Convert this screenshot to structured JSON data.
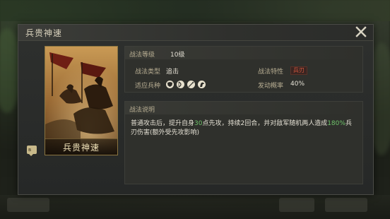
{
  "modal": {
    "title": "兵贵神速",
    "card": {
      "name": "兵贵神速"
    },
    "info": {
      "level_label": "战法等级",
      "level_value": "10级",
      "type_label": "战法类型",
      "type_value": "追击",
      "trait_label": "战法特性",
      "trait_value": "兵刃",
      "troops_label": "适应兵种",
      "troop_icons": [
        "shield-troop-icon",
        "bow-troop-icon",
        "spear-troop-icon",
        "horse-troop-icon"
      ],
      "rate_label": "发动概率",
      "rate_value": "40%"
    },
    "description": {
      "heading": "战法说明",
      "part1": "普通攻击后，提升自身",
      "num1": "30",
      "part2": "点先攻，持续2回合，并对敌军随机两人造成",
      "num2": "180%",
      "part3": "兵刃伤害(额外受先攻影响)"
    }
  },
  "colors": {
    "highlight": "#6ec16a",
    "trait": "#d2573e",
    "label": "#b7ad92"
  }
}
